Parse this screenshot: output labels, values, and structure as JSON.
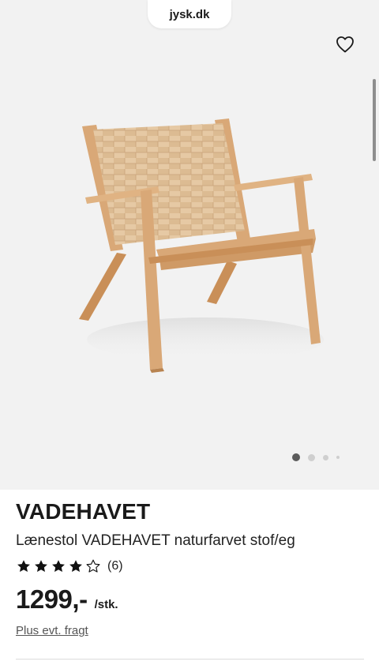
{
  "browser": {
    "url": "jysk.dk"
  },
  "gallery": {
    "favorite_icon": "heart-outline-icon",
    "image_alt": "Lænestol VADEHAVET naturfarvet stof/eg",
    "active_index": 1,
    "total_images": 4
  },
  "product": {
    "name": "VADEHAVET",
    "description": "Lænestol VADEHAVET naturfarvet stof/eg",
    "rating": {
      "stars_filled": 4,
      "stars_total": 5,
      "count": "(6)"
    },
    "price": "1299,-",
    "unit": "/stk.",
    "freight_link": "Plus evt. fragt"
  },
  "colors": {
    "hero_background": "#f2f2f2",
    "wood": "#d9a877",
    "webbing": "#e6c9a4"
  }
}
